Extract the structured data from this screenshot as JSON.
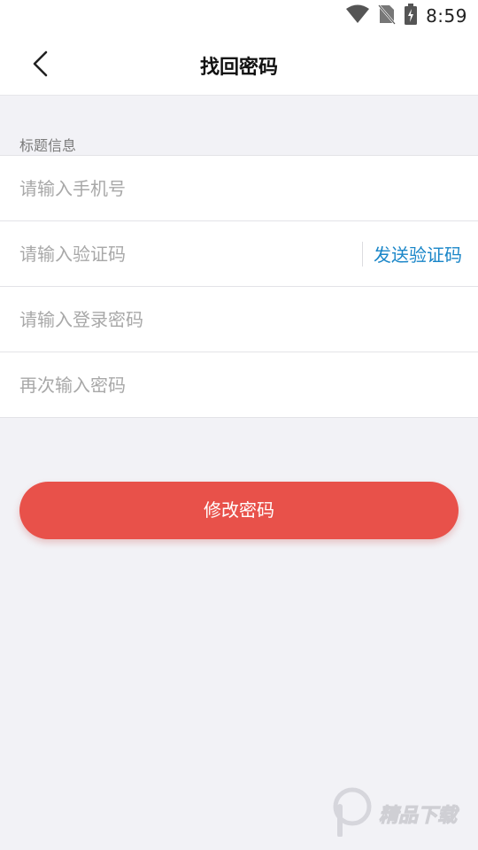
{
  "status_bar": {
    "time": "8:59",
    "icons": [
      "wifi-icon",
      "no-sim-icon",
      "battery-charging-icon"
    ]
  },
  "header": {
    "title": "找回密码",
    "back_icon": "chevron-left-icon"
  },
  "section": {
    "label": "标题信息"
  },
  "form": {
    "phone_placeholder": "请输入手机号",
    "code_placeholder": "请输入验证码",
    "send_code_label": "发送验证码",
    "password_placeholder": "请输入登录密码",
    "confirm_placeholder": "再次输入密码"
  },
  "submit": {
    "label": "修改密码"
  },
  "watermark": {
    "text": "精品下载",
    "icon": "p-logo-icon"
  },
  "colors": {
    "accent": "#e8514a",
    "link": "#1a86c8",
    "background": "#f2f2f6"
  }
}
